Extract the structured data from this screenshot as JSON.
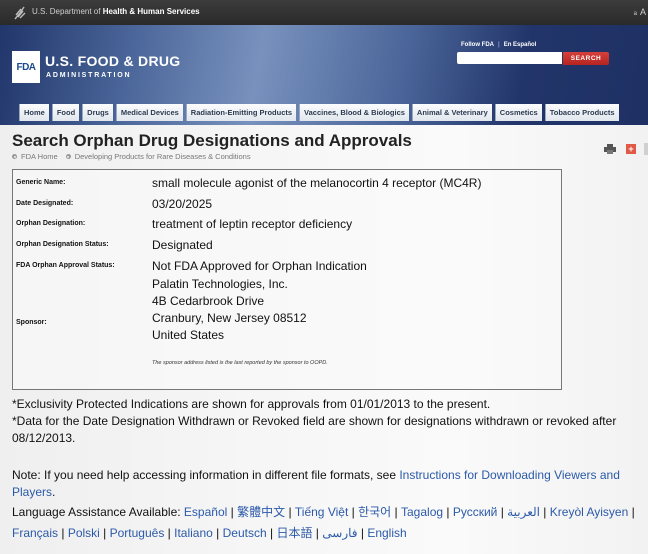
{
  "hhs_bar": {
    "prefix": "U.S. Department of ",
    "agency": "Health & Human Services",
    "text_size_small": "a",
    "text_size_large": "A"
  },
  "header": {
    "logo_badge": "FDA",
    "name": "U.S. FOOD & DRUG",
    "subname": "ADMINISTRATION",
    "follow_link": "Follow FDA",
    "espanol_link": "En Español",
    "search_placeholder": "",
    "search_value": "",
    "search_button": "SEARCH"
  },
  "nav_tabs": [
    "Home",
    "Food",
    "Drugs",
    "Medical Devices",
    "Radiation-Emitting Products",
    "Vaccines, Blood & Biologics",
    "Animal & Veterinary",
    "Cosmetics",
    "Tobacco Products"
  ],
  "page": {
    "title": "Search Orphan Drug Designations and Approvals",
    "breadcrumb": [
      "FDA Home",
      "Developing Products for Rare Diseases & Conditions"
    ]
  },
  "details": {
    "generic_name_label": "Generic Name:",
    "generic_name": "small molecule agonist of the melanocortin 4 receptor (MC4R)",
    "date_designated_label": "Date Designated:",
    "date_designated": "03/20/2025",
    "orphan_designation_label": "Orphan Designation:",
    "orphan_designation": "treatment of leptin receptor deficiency",
    "designation_status_label": "Orphan Designation Status:",
    "designation_status": "Designated",
    "approval_status_label": "FDA Orphan Approval Status:",
    "approval_status": "Not FDA Approved for Orphan Indication",
    "sponsor_label": "Sponsor:",
    "sponsor_lines": [
      "Palatin Technologies, Inc.",
      "4B Cedarbrook Drive",
      "Cranbury, New Jersey 08512",
      "United States"
    ],
    "sponsor_note": "The sponsor address listed is the last reported by the sponsor to OOPD."
  },
  "footnotes": {
    "exclusivity": "*Exclusivity Protected Indications are shown for approvals from 01/01/2013 to the present.",
    "withdrawn": "*Data for the Date Designation Withdrawn or Revoked field are shown for designations withdrawn or revoked after 08/12/2013."
  },
  "note": {
    "text": "Note: If you need help accessing information in different file formats, see ",
    "link": "Instructions for Downloading Viewers and Players",
    "end": "."
  },
  "language_assistance": {
    "label": "Language Assistance Available: ",
    "languages": [
      "Español",
      "繁體中文",
      "Tiếng Việt",
      "한국어",
      "Tagalog",
      "Русский",
      "العربية",
      "Kreyòl Ayisyen",
      "Français",
      "Polski",
      "Português",
      "Italiano",
      "Deutsch",
      "日本語",
      "فارسی",
      "English"
    ]
  }
}
